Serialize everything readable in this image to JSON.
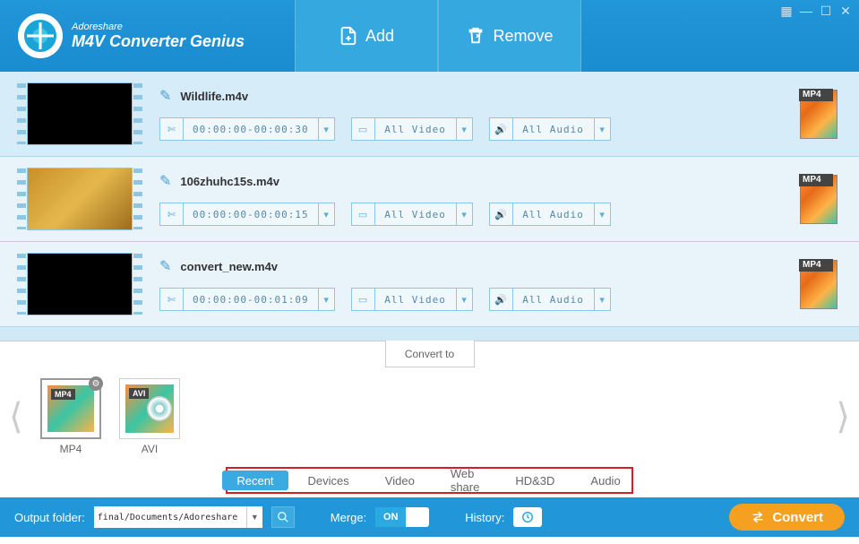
{
  "header": {
    "brand": "Adoreshare",
    "product": "M4V Converter Genius",
    "add_label": "Add",
    "remove_label": "Remove"
  },
  "files": [
    {
      "name": "Wildlife.m4v",
      "trim": "00:00:00-00:00:30",
      "video": "All Video",
      "audio": "All Audio",
      "format": "MP4",
      "thumb": "black",
      "selected": true
    },
    {
      "name": "106zhuhc15s.m4v",
      "trim": "00:00:00-00:00:15",
      "video": "All Video",
      "audio": "All Audio",
      "format": "MP4",
      "thumb": "gold",
      "selected": false
    },
    {
      "name": "convert_new.m4v",
      "trim": "00:00:00-00:01:09",
      "video": "All Video",
      "audio": "All Audio",
      "format": "MP4",
      "thumb": "black",
      "selected": false
    }
  ],
  "convert_to_label": "Convert to",
  "formats": [
    {
      "code": "MP4",
      "caption": "MP4",
      "active": true
    },
    {
      "code": "AVI",
      "caption": "AVI",
      "active": false
    }
  ],
  "categories": [
    "Recent",
    "Devices",
    "Video",
    "Web share",
    "HD&3D",
    "Audio"
  ],
  "active_category": "Recent",
  "footer": {
    "output_label": "Output folder:",
    "output_path": "final/Documents/Adoreshare",
    "merge_label": "Merge:",
    "merge_state": "ON",
    "history_label": "History:",
    "convert_label": "Convert"
  }
}
